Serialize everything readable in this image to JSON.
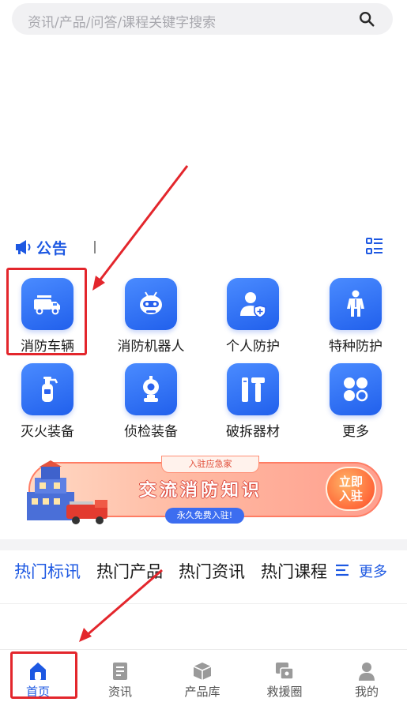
{
  "search": {
    "placeholder": "资讯/产品/问答/课程关键字搜索"
  },
  "notice": {
    "label": "公告"
  },
  "categories": [
    {
      "label": "消防车辆",
      "icon": "fire-truck-icon"
    },
    {
      "label": "消防机器人",
      "icon": "robot-icon"
    },
    {
      "label": "个人防护",
      "icon": "person-shield-icon"
    },
    {
      "label": "特种防护",
      "icon": "protective-suit-icon"
    },
    {
      "label": "灭火装备",
      "icon": "fire-extinguisher-icon"
    },
    {
      "label": "侦检装备",
      "icon": "detector-icon"
    },
    {
      "label": "破拆器材",
      "icon": "demolition-tools-icon"
    },
    {
      "label": "更多",
      "icon": "more-grid-icon"
    }
  ],
  "banner": {
    "tag": "入驻应急家",
    "title": "交流消防知识",
    "subtitle": "永久免费入驻!",
    "cta_line1": "立即",
    "cta_line2": "入驻"
  },
  "hot_tabs": {
    "items": [
      {
        "label": "热门标讯",
        "active": true
      },
      {
        "label": "热门产品",
        "active": false
      },
      {
        "label": "热门资讯",
        "active": false
      },
      {
        "label": "热门课程",
        "active": false
      }
    ],
    "more_label": "更多"
  },
  "bottom_nav": [
    {
      "label": "首页",
      "icon": "home-icon",
      "active": true
    },
    {
      "label": "资讯",
      "icon": "news-icon",
      "active": false
    },
    {
      "label": "产品库",
      "icon": "product-box-icon",
      "active": false
    },
    {
      "label": "救援圈",
      "icon": "rescue-circle-icon",
      "active": false
    },
    {
      "label": "我的",
      "icon": "user-icon",
      "active": false
    }
  ],
  "colors": {
    "accent": "#1d58e2",
    "highlight": "#e3262c",
    "tile_gradient_start": "#4a8bff",
    "tile_gradient_end": "#2160ec"
  }
}
